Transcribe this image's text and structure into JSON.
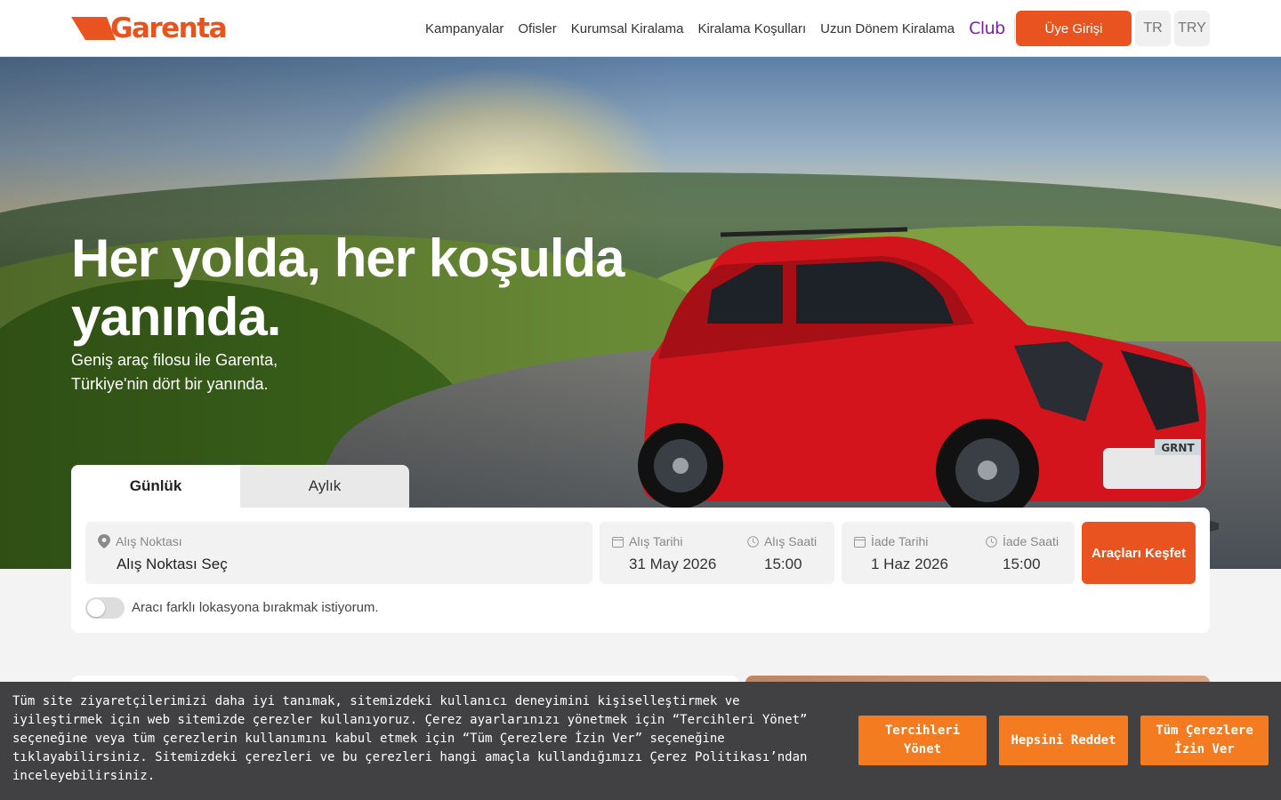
{
  "header": {
    "logo_text": "Garenta",
    "nav": [
      "Kampanyalar",
      "Ofisler",
      "Kurumsal Kiralama",
      "Kiralama Koşulları",
      "Uzun Dönem Kiralama"
    ],
    "club_label": "Club",
    "login_label": "Üye Girişi",
    "language": "TR",
    "currency": "TRY"
  },
  "hero": {
    "title": "Her yolda, her koşulda yanında.",
    "subtitle": "Geniş araç filosu ile Garenta, Türkiye'nin dört bir yanında.",
    "plate_text": "GRNT"
  },
  "booking": {
    "tabs": [
      "Günlük",
      "Aylık"
    ],
    "active_tab": "Günlük",
    "pickup_location_label": "Alış Noktası",
    "pickup_location_value": "Alış Noktası Seç",
    "pickup_date_label": "Alış Tarihi",
    "pickup_date_value": "31 May 2026",
    "pickup_time_label": "Alış Saati",
    "pickup_time_value": "15:00",
    "return_date_label": "İade Tarihi",
    "return_date_value": "1 Haz 2026",
    "return_time_label": "İade Saati",
    "return_time_value": "15:00",
    "search_label": "Araçları Keşfet",
    "different_location_label": "Aracı farklı lokasyona bırakmak istiyorum.",
    "different_location_enabled": false
  },
  "cookie": {
    "text": "Tüm site ziyaretçilerimizi daha iyi tanımak, sitemizdeki kullanıcı deneyimini kişiselleştirmek ve iyileştirmek için web sitemizde çerezler kullanıyoruz. Çerez ayarlarınızı yönetmek için “Tercihleri Yönet” seçeneğine veya tüm çerezlerin kullanımını kabul etmek için “Tüm Çerezlere İzin Ver” seçeneğine tıklayabilirsiniz. Sitemizdeki çerezleri ve bu çerezleri hangi amaçla kullandığımızı Çerez Politikası’ndan inceleyebilirsiniz.",
    "manage_label": "Tercihleri Yönet",
    "reject_label": "Hepsini Reddet",
    "accept_label": "Tüm Çerezlere İzin Ver"
  },
  "colors": {
    "brand": "#e8531f",
    "club": "#7a1fa2",
    "cookie_bg": "#414143",
    "cookie_button": "#f47b20",
    "car": "#d4141c"
  },
  "icons": [
    "location-pin-icon",
    "calendar-icon",
    "clock-icon"
  ]
}
